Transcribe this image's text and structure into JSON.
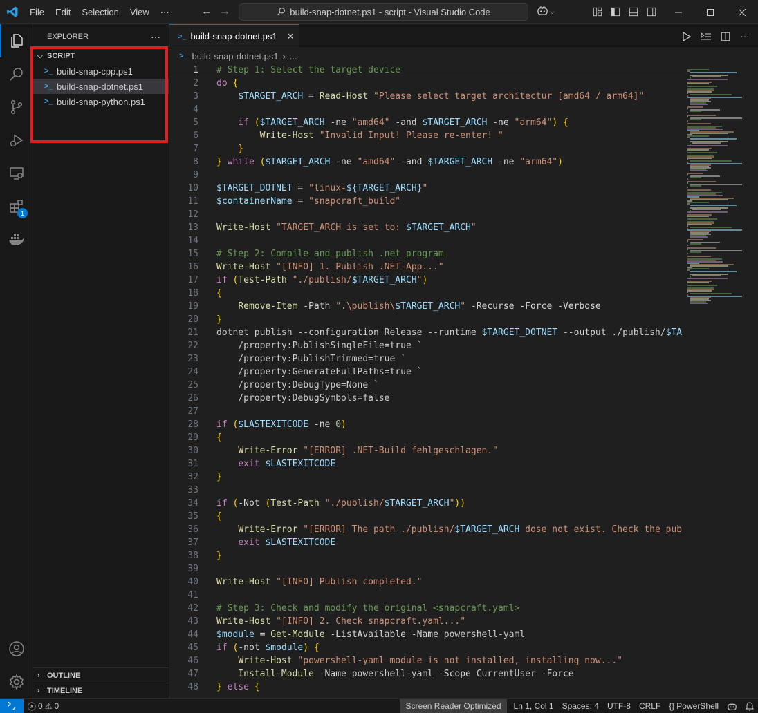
{
  "titlebar": {
    "menu": [
      "File",
      "Edit",
      "Selection",
      "View",
      "···"
    ],
    "search_text": "build-snap-dotnet.ps1 - script - Visual Studio Code"
  },
  "activity": {
    "extensions_badge": "1"
  },
  "sidebar": {
    "header": "EXPLORER",
    "more": "···",
    "folder": "SCRIPT",
    "files": [
      "build-snap-cpp.ps1",
      "build-snap-dotnet.ps1",
      "build-snap-python.ps1"
    ],
    "outline": "OUTLINE",
    "timeline": "TIMELINE"
  },
  "editor": {
    "tab_label": "build-snap-dotnet.ps1",
    "breadcrumb_file": "build-snap-dotnet.ps1",
    "breadcrumb_more": "...",
    "lines": [
      "# Step 1: Select the target device",
      "do {",
      "    $TARGET_ARCH = Read-Host \"Please select target architectur [amd64 / arm64]\"",
      "",
      "    if ($TARGET_ARCH -ne \"amd64\" -and $TARGET_ARCH -ne \"arm64\") {",
      "        Write-Host \"Invalid Input! Please re-enter! \"",
      "    }",
      "} while ($TARGET_ARCH -ne \"amd64\" -and $TARGET_ARCH -ne \"arm64\")",
      "",
      "$TARGET_DOTNET = \"linux-${TARGET_ARCH}\"",
      "$containerName = \"snapcraft_build\"",
      "",
      "Write-Host \"TARGET_ARCH is set to: $TARGET_ARCH\"",
      "",
      "# Step 2: Compile and publish .net program",
      "Write-Host \"[INFO] 1. Publish .NET-App...\"",
      "if (Test-Path \"./publish/$TARGET_ARCH\")",
      "{",
      "    Remove-Item -Path \".\\publish\\$TARGET_ARCH\" -Recurse -Force -Verbose",
      "}",
      "dotnet publish --configuration Release --runtime $TARGET_DOTNET --output ./publish/$TARG",
      "    /property:PublishSingleFile=true `",
      "    /property:PublishTrimmed=true `",
      "    /property:GenerateFullPaths=true `",
      "    /property:DebugType=None `",
      "    /property:DebugSymbols=false",
      "",
      "if ($LASTEXITCODE -ne 0)",
      "{",
      "    Write-Error \"[ERROR] .NET-Build fehlgeschlagen.\"",
      "    exit $LASTEXITCODE",
      "}",
      "",
      "if (-Not (Test-Path \"./publish/$TARGET_ARCH\"))",
      "{",
      "    Write-Error \"[ERROR] The path ./publish/$TARGET_ARCH dose not exist. Check the publi",
      "    exit $LASTEXITCODE",
      "}",
      "",
      "Write-Host \"[INFO] Publish completed.\"",
      "",
      "# Step 3: Check and modify the original <snapcraft.yaml>",
      "Write-Host \"[INFO] 2. Check snapcraft.yaml...\"",
      "$module = Get-Module -ListAvailable -Name powershell-yaml",
      "if (-not $module) {",
      "    Write-Host \"powershell-yaml module is not installed, installing now...\"",
      "    Install-Module -Name powershell-yaml -Scope CurrentUser -Force",
      "} else {"
    ]
  },
  "statusbar": {
    "errors": "0",
    "warnings": "0",
    "screen_reader": "Screen Reader Optimized",
    "position": "Ln 1, Col 1",
    "spaces": "Spaces: 4",
    "encoding": "UTF-8",
    "eol": "CRLF",
    "language": "PowerShell"
  },
  "colors": {
    "accent": "#0078d4",
    "highlight_box": "#e51c23",
    "comment": "#6a9955",
    "keyword": "#c586c0",
    "variable": "#9cdcfe",
    "string": "#ce9178",
    "command": "#dcdcaa"
  }
}
